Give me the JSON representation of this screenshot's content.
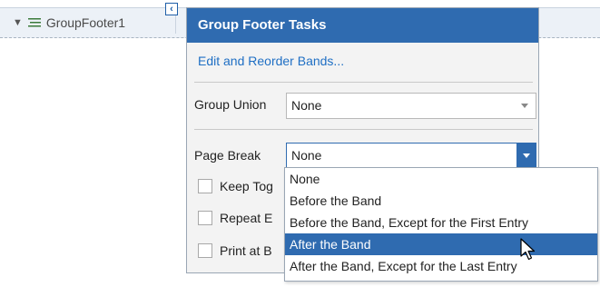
{
  "band": {
    "name": "GroupFooter1"
  },
  "panel": {
    "title": "Group Footer Tasks",
    "link_label": "Edit and Reorder Bands...",
    "group_union": {
      "label": "Group Union",
      "value": "None"
    },
    "page_break": {
      "label": "Page Break",
      "value": "None"
    },
    "checkboxes": [
      {
        "label": "Keep Tog"
      },
      {
        "label": "Repeat E"
      },
      {
        "label": "Print at B"
      }
    ]
  },
  "dropdown": {
    "options": [
      "None",
      "Before the Band",
      "Before the Band, Except for the First Entry",
      "After the Band",
      "After the Band, Except for the Last Entry"
    ],
    "selected_index": 3
  },
  "colors": {
    "accent": "#2f6bb0",
    "link": "#1f6fc4"
  },
  "icons": {
    "collapse": "collapse-triangle-icon",
    "band": "band-lines-icon",
    "smart_tag": "smart-tag-icon",
    "cursor": "mouse-pointer-icon"
  }
}
